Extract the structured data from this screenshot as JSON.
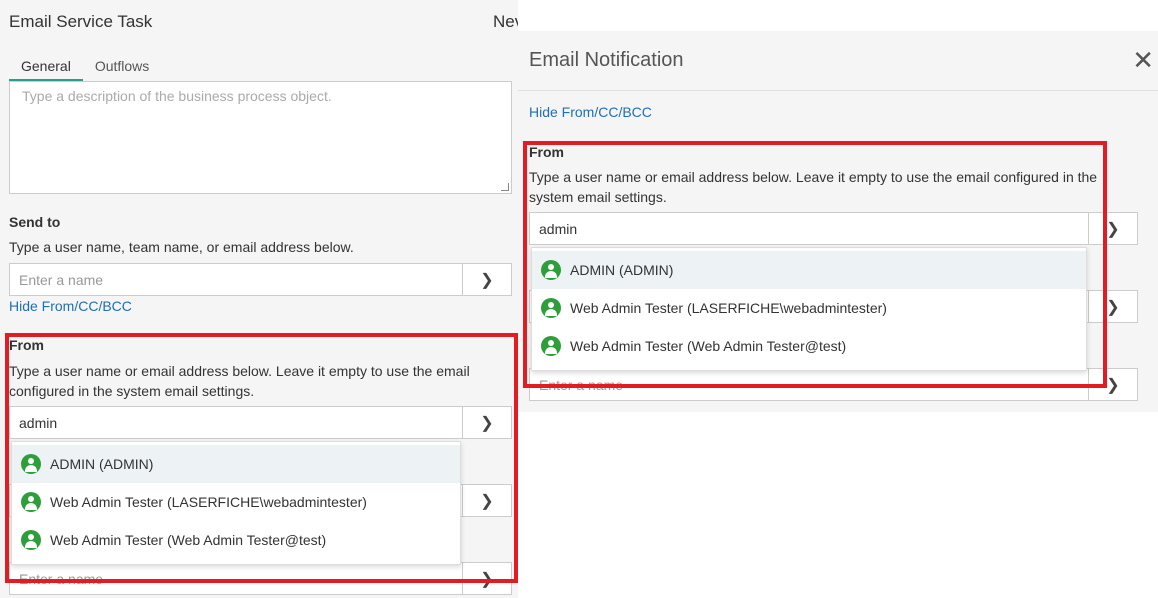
{
  "left": {
    "title": "Email Service Task",
    "title_cut": "Nev",
    "tabs": [
      {
        "label": "General"
      },
      {
        "label": "Outflows"
      }
    ],
    "description_placeholder": "Type a description of the business process object.",
    "send_to": {
      "label": "Send to",
      "help": "Type a user name, team name, or email address below.",
      "placeholder": "Enter a name"
    },
    "hide_link": "Hide From/CC/BCC",
    "from": {
      "label": "From",
      "help": "Type a user name or email address below. Leave it empty to use the email configured in the system email settings.",
      "value": "admin"
    },
    "next_placeholder": "Enter a name"
  },
  "right": {
    "title": "Email Notification",
    "hide_link": "Hide From/CC/BCC",
    "from": {
      "label": "From",
      "help": "Type a user name or email address below. Leave it empty to use the email configured in the system email settings.",
      "value": "admin"
    },
    "next_placeholder": "Enter a name"
  },
  "suggestions": [
    {
      "label": "ADMIN (ADMIN)"
    },
    {
      "label": "Web Admin Tester (LASERFICHE\\webadmintester)"
    },
    {
      "label": "Web Admin Tester (Web Admin Tester@test)"
    }
  ],
  "icons": {
    "user": "user-circle-icon",
    "go": "chevron-right-icon",
    "close": "close-icon"
  },
  "colors": {
    "highlight_border": "#e31b23",
    "link": "#1e6fb5",
    "user_icon": "#2e9e3b",
    "tab_active": "#2a9d8f"
  }
}
